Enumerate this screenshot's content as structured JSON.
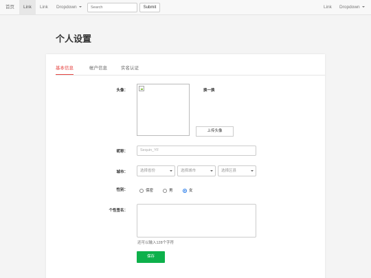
{
  "navbar": {
    "brand": "首页",
    "links": [
      "Link",
      "Link"
    ],
    "dropdown_label": "Dropdown",
    "search_placeholder": "Search",
    "submit_label": "Submit",
    "right_link": "Link",
    "right_dropdown_label": "Dropdown"
  },
  "page_title": "个人设置",
  "tabs": [
    {
      "label": "基本信息",
      "active": true
    },
    {
      "label": "帐户信息",
      "active": false
    },
    {
      "label": "实名认证",
      "active": false
    }
  ],
  "form": {
    "avatar_label": "头像：",
    "swap_link": "换一换",
    "upload_button": "上传头像",
    "nickname_label": "昵称：",
    "nickname_value": "Sequin_YF",
    "city_label": "城市：",
    "province_select": "选择省份",
    "city_select": "选择城市",
    "district_select": "选择区县",
    "gender_label": "性别：",
    "gender_options": [
      {
        "label": "保密",
        "checked": false
      },
      {
        "label": "男",
        "checked": false
      },
      {
        "label": "女",
        "checked": true
      }
    ],
    "signature_label": "个性签名：",
    "signature_hint": "还可以输入128个字符",
    "save_button": "保存"
  },
  "colors": {
    "accent_tab": "#e64340",
    "save_button": "#0db04b",
    "radio_checked": "#1a73e8"
  }
}
